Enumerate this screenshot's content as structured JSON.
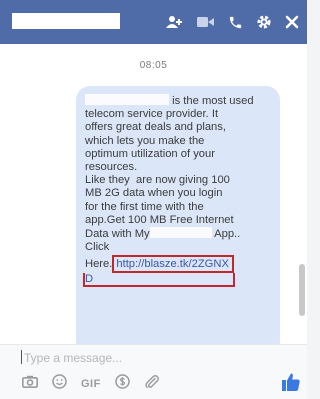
{
  "header": {
    "icons": [
      "add-people-icon",
      "video-call-icon",
      "phone-icon",
      "gear-icon",
      "close-icon"
    ]
  },
  "conversation": {
    "timestamp": "08:05",
    "message": {
      "lines": [
        "is the most used",
        "telecom service provider. It",
        "offers great deals and plans,",
        "which lets you make the",
        "optimum utilization of your",
        "resources.",
        "Like they  are now giving 100",
        "MB 2G data when you login",
        "for the first time with the",
        "app.Get 100 MB Free Internet",
        "Data with My",
        "App.."
      ],
      "click_label": "Click",
      "here_label": "Here.",
      "link_text": "http://blasze.tk/2ZGNX",
      "link_tail": "D"
    }
  },
  "composer": {
    "placeholder": "Type a message...",
    "gif_label": "GIF",
    "tool_icons": [
      "camera-icon",
      "sticker-icon",
      "gif-icon",
      "payment-icon",
      "attachment-icon"
    ],
    "like_icon": "thumbs-up-icon"
  },
  "colors": {
    "header_bg": "#4f6ba8",
    "bubble_bg": "#dbe6f8",
    "link_color": "#3a58a8",
    "highlight_border": "#c1272d",
    "like_color": "#3b7ae0"
  }
}
